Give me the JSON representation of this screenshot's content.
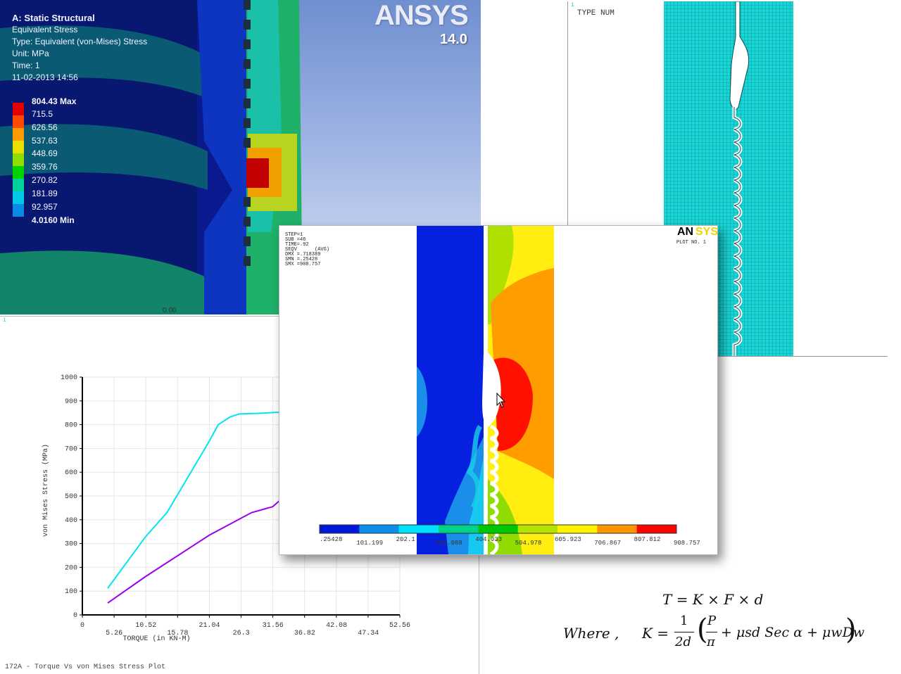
{
  "workbench": {
    "title": "A: Static Structural",
    "lines": [
      "Equivalent Stress",
      "Type: Equivalent (von-Mises) Stress",
      "Unit: MPa",
      "Time: 1",
      "11-02-2013 14:56"
    ],
    "logo": "ANSYS",
    "version": "14.0",
    "scale_mark": "0.00",
    "legend": [
      {
        "label": "804.43 Max",
        "color": "#e60000"
      },
      {
        "label": "715.5",
        "color": "#ff4c00"
      },
      {
        "label": "626.56",
        "color": "#ff9a00"
      },
      {
        "label": "537.63",
        "color": "#e7e100"
      },
      {
        "label": "448.69",
        "color": "#8fe000"
      },
      {
        "label": "359.76",
        "color": "#00d400"
      },
      {
        "label": "270.82",
        "color": "#00d39a"
      },
      {
        "label": "181.89",
        "color": "#00c8e6"
      },
      {
        "label": "92.957",
        "color": "#0a8ae6"
      },
      {
        "label": "4.0160 Min",
        "color": "#0a1ad0"
      }
    ]
  },
  "mesh": {
    "corner": "1",
    "label": "TYPE NUM"
  },
  "contour": {
    "info": [
      "STEP=1",
      "SUB =46",
      "TIME=.92",
      "SEQV      (AVG)",
      "DMX =.718389",
      "SMN =.25428",
      "SMX =908.757"
    ],
    "logo_a": "AN",
    "logo_b": "SYS",
    "plot_no": "PLOT NO.   1",
    "corner": "1",
    "colorbar_labels": [
      ".25428",
      "101.199",
      "202.1",
      "303.088",
      "404.033",
      "504.978",
      "605.923",
      "706.867",
      "807.812",
      "908.757"
    ],
    "colorbar_colors": [
      "#0018d8",
      "#0a8ee6",
      "#00e0ff",
      "#00d28a",
      "#00c800",
      "#b4e400",
      "#fff200",
      "#ff9600",
      "#ff0000"
    ]
  },
  "chart_data": {
    "type": "line",
    "title": "172A - Torque Vs von Mises Stress Plot",
    "xlabel": "TORQUE (in KN-M)",
    "ylabel": "von Mises Stress (MPa)",
    "corner": "1",
    "xlim": [
      0,
      52.56
    ],
    "ylim": [
      0,
      1000
    ],
    "xticks_upper": [
      "0",
      "10.52",
      "21.04",
      "31.56",
      "42.08",
      "52.56"
    ],
    "xticks_lower": [
      "5.26",
      "15.78",
      "26.3",
      "36.82",
      "47.34"
    ],
    "yticks": [
      "0",
      "100",
      "200",
      "300",
      "400",
      "500",
      "600",
      "700",
      "800",
      "900",
      "1000"
    ],
    "series": [
      {
        "color": "#00e5f0",
        "x": [
          4.2,
          10.5,
          14.0,
          21.0,
          22.5,
          24.5,
          26.0,
          29.5,
          32.5,
          36.5
        ],
        "y": [
          112,
          330,
          430,
          730,
          800,
          833,
          845,
          848,
          852,
          855
        ]
      },
      {
        "color": "#9900ee",
        "x": [
          4.2,
          10.5,
          21.0,
          28.0,
          31.5,
          36.5
        ],
        "y": [
          50,
          162,
          335,
          430,
          455,
          565
        ]
      }
    ]
  },
  "formula": {
    "line1": "T = K × F × d",
    "where": "Where ,",
    "k_lhs": "K =",
    "one": "1",
    "two_d": "2d",
    "P": "P",
    "pi": "π",
    "mid": "+ μsd Sec α + μwDw"
  }
}
